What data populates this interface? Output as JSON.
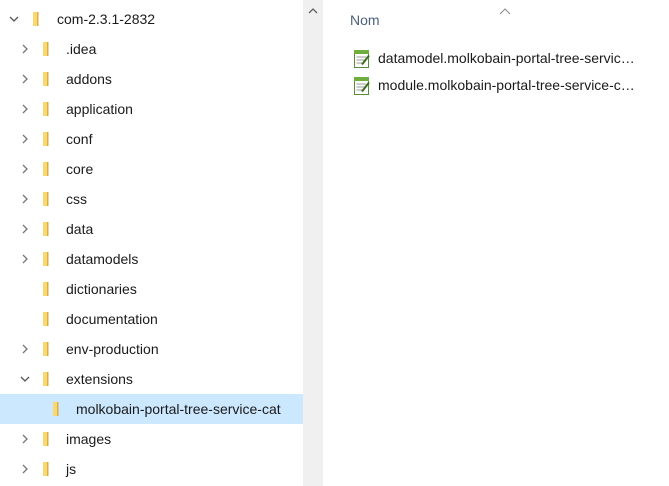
{
  "tree": {
    "root": {
      "label": "com-2.3.1-2832",
      "expanded": true
    },
    "items": [
      {
        "label": ".idea",
        "has_children": true,
        "expanded": false
      },
      {
        "label": "addons",
        "has_children": true,
        "expanded": false
      },
      {
        "label": "application",
        "has_children": true,
        "expanded": false
      },
      {
        "label": "conf",
        "has_children": true,
        "expanded": false
      },
      {
        "label": "core",
        "has_children": true,
        "expanded": false
      },
      {
        "label": "css",
        "has_children": true,
        "expanded": false
      },
      {
        "label": "data",
        "has_children": true,
        "expanded": false
      },
      {
        "label": "datamodels",
        "has_children": true,
        "expanded": false
      },
      {
        "label": "dictionaries",
        "has_children": false
      },
      {
        "label": "documentation",
        "has_children": false
      },
      {
        "label": "env-production",
        "has_children": true,
        "expanded": false
      },
      {
        "label": "extensions",
        "has_children": true,
        "expanded": true
      },
      {
        "label": "molkobain-portal-tree-service-cat",
        "has_children": false,
        "selected": true,
        "child": true
      },
      {
        "label": "images",
        "has_children": true,
        "expanded": false
      },
      {
        "label": "js",
        "has_children": true,
        "expanded": false
      }
    ]
  },
  "file_list": {
    "column_header": "Nom",
    "sort": "ascending",
    "files": [
      {
        "name": "datamodel.molkobain-portal-tree-servic…",
        "icon": "php-file-icon"
      },
      {
        "name": "module.molkobain-portal-tree-service-c…",
        "icon": "php-file-icon"
      }
    ]
  },
  "colors": {
    "selection": "#cce8ff",
    "folder_yellow": "#f8d775",
    "header_text": "#4c607a",
    "scrollbar": "#f0f0f0"
  }
}
